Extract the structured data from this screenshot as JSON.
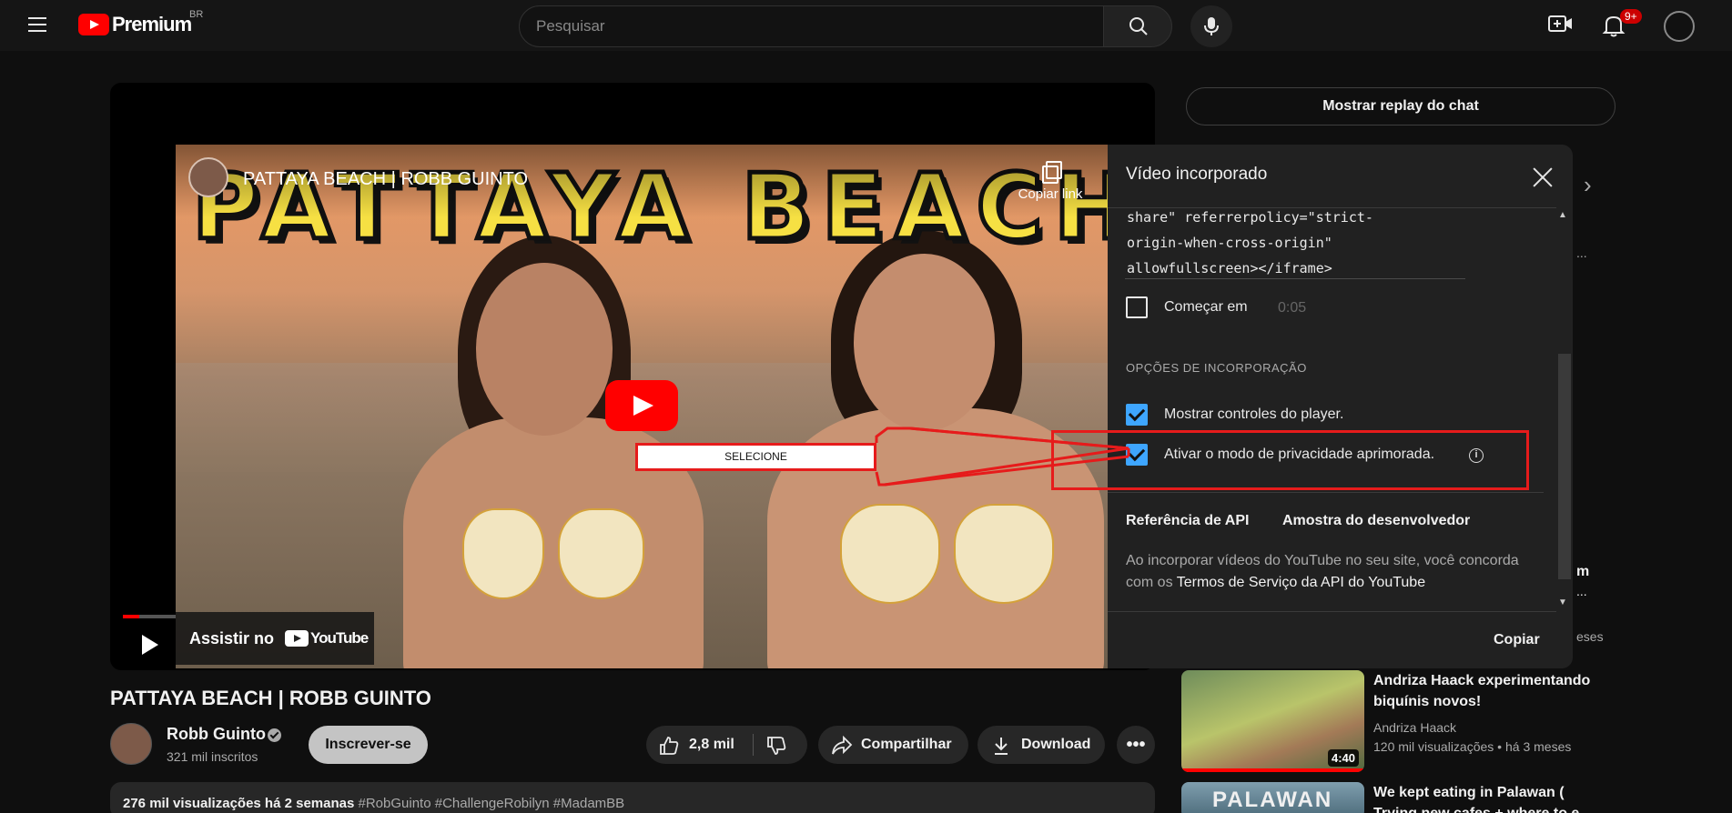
{
  "header": {
    "brand": "Premium",
    "region": "BR",
    "search_placeholder": "Pesquisar",
    "notification_count": "9+"
  },
  "chat": {
    "replay_label": "Mostrar replay do chat"
  },
  "embed_preview": {
    "video_title": "PATTAYA BEACH | ROBB GUINTO",
    "thumbnail_text": "PATTAYA BEACH",
    "copy_link_label": "Copiar link",
    "watch_on_label": "Assistir no",
    "watch_on_brand": "YouTube"
  },
  "annotation": {
    "label": "SELECIONE"
  },
  "embed_dialog": {
    "title": "Vídeo incorporado",
    "code_snippet": "share\" referrerpolicy=\"strict-\norigin-when-cross-origin\"\nallowfullscreen></iframe>",
    "start_at_label": "Começar em",
    "start_at_value": "0:05",
    "start_at_checked": false,
    "options_heading": "OPÇÕES DE INCORPORAÇÃO",
    "options": [
      {
        "label": "Mostrar controles do player.",
        "checked": true
      },
      {
        "label": "Ativar o modo de privacidade aprimorada.",
        "checked": true
      }
    ],
    "links": [
      "Referência de API",
      "Amostra do desenvolvedor"
    ],
    "terms_prefix": "Ao incorporar vídeos do YouTube no seu site, você concorda com os ",
    "terms_link": "Termos de Serviço da API do YouTube",
    "copy_label": "Copiar"
  },
  "video": {
    "title": "PATTAYA BEACH | ROBB GUINTO",
    "channel": "Robb Guinto",
    "subscribers": "321 mil inscritos",
    "subscribe_label": "Inscrever-se",
    "likes": "2,8 mil",
    "share_label": "Compartilhar",
    "download_label": "Download",
    "description_stats": "276 mil visualizações  há 2 semanas",
    "description_tags": "#RobGuinto #ChallengeRobilyn #MadamBB"
  },
  "sidebar": {
    "fragments": [
      "...",
      "m",
      "...",
      "eses"
    ],
    "cards": [
      {
        "title": "Andriza Haack experimentando biquínis novos!",
        "channel": "Andriza Haack",
        "views": "120 mil visualizações",
        "age": "há 3 meses",
        "duration": "4:40"
      },
      {
        "title": "We kept eating in Palawan ( Trying new cafes + where to e...",
        "thumb_text": "PALAWAN"
      }
    ]
  }
}
